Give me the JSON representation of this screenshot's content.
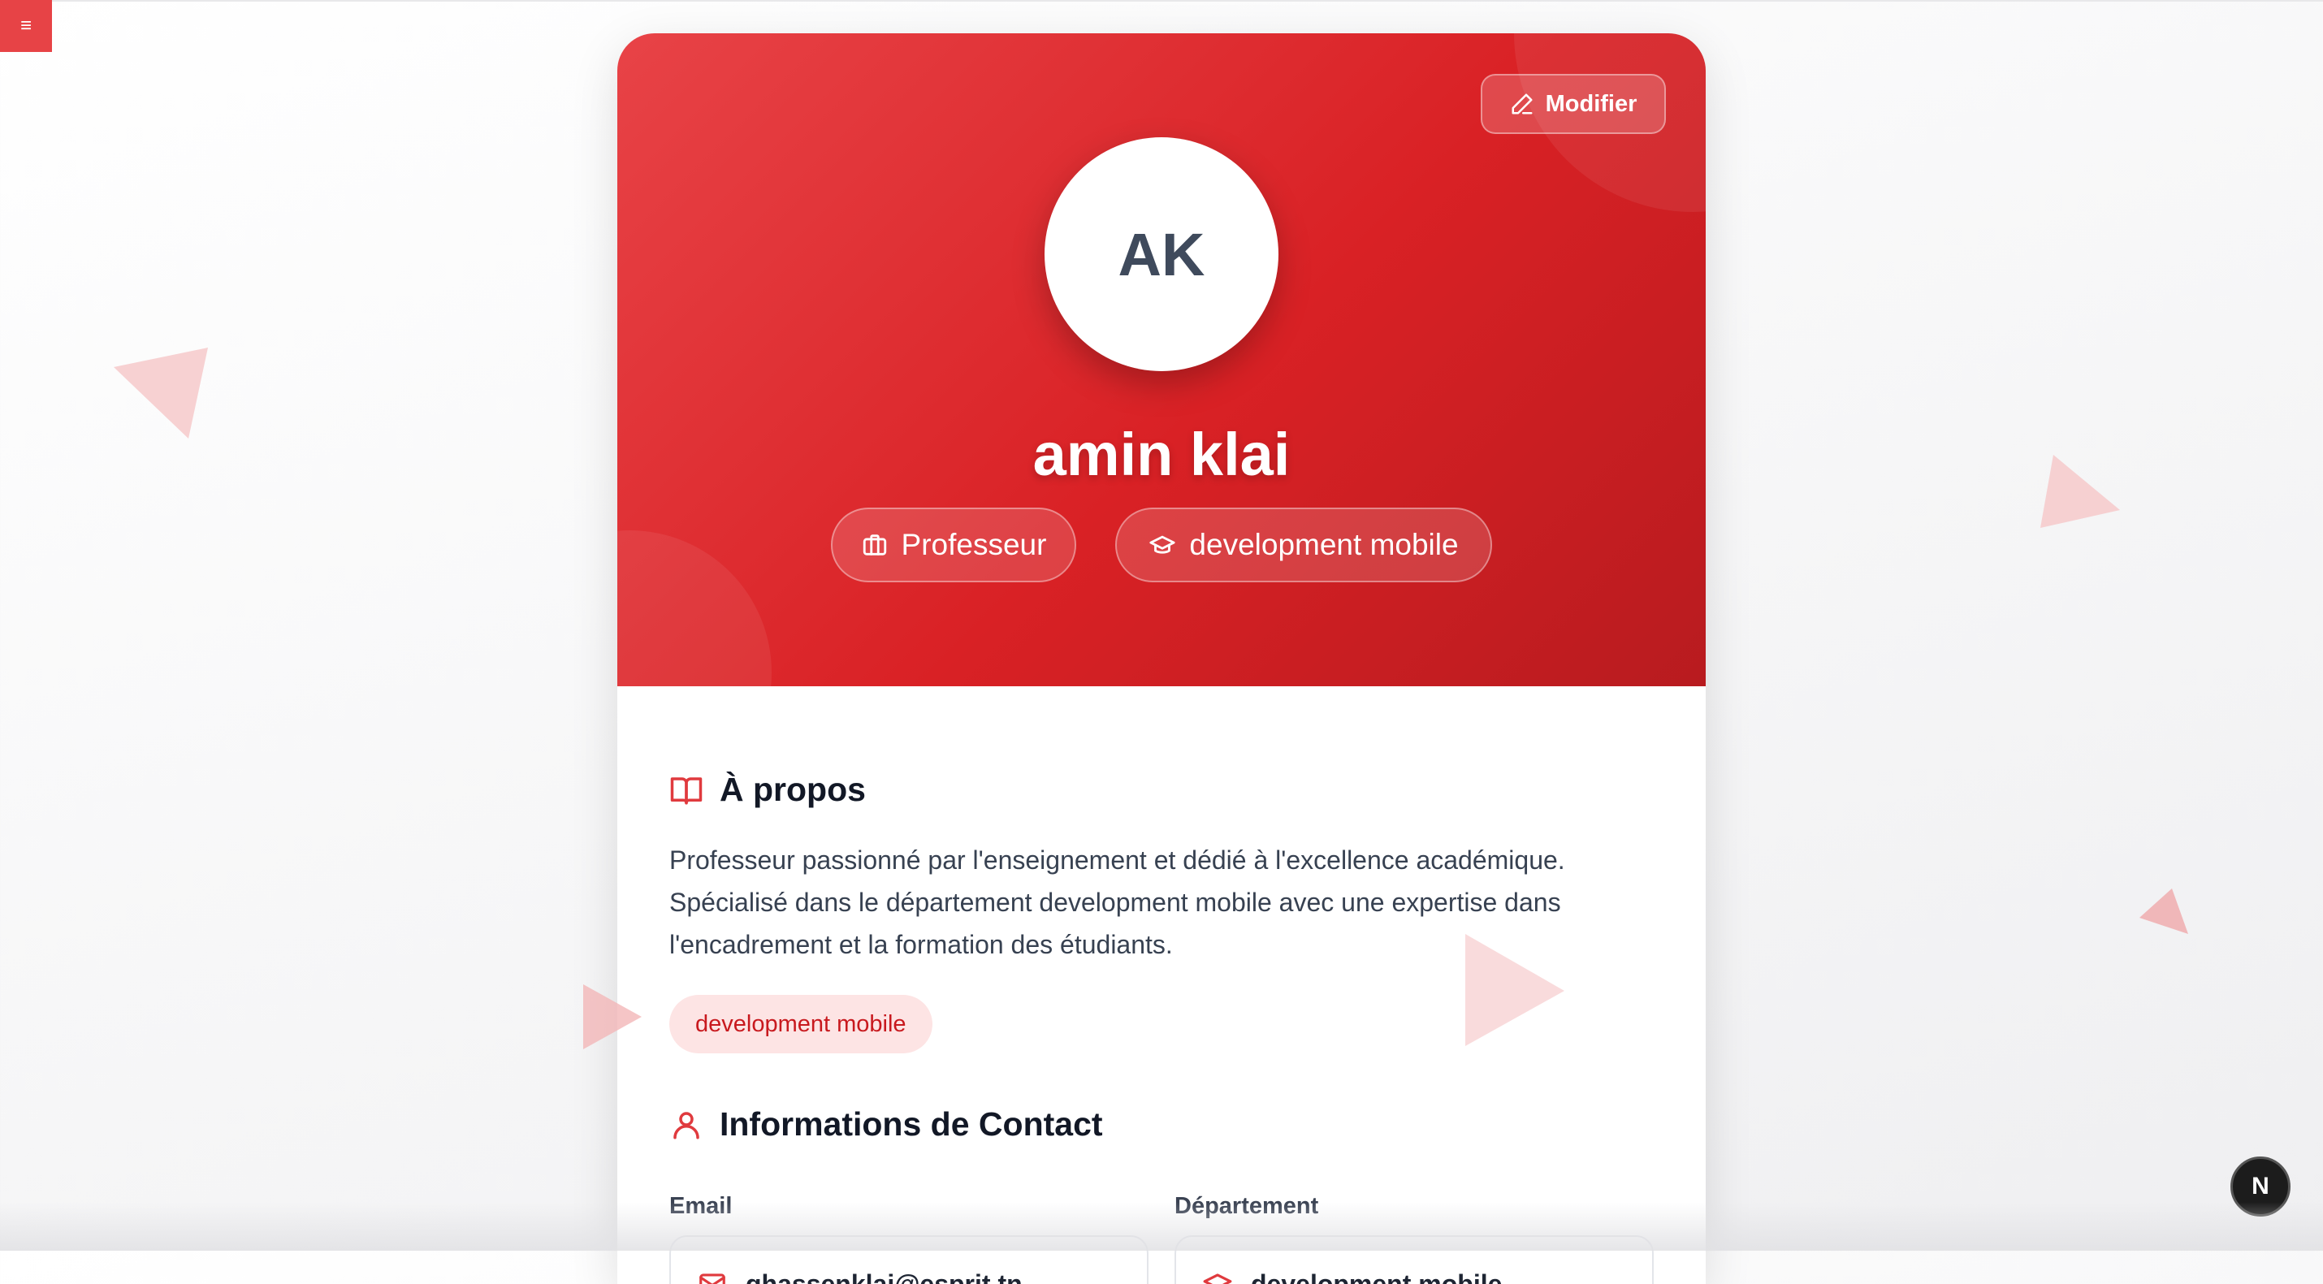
{
  "menu": {
    "icon": "menu-icon",
    "glyph": "≡"
  },
  "header": {
    "edit_label": "Modifier",
    "avatar_initials": "AK",
    "name": "amin klai",
    "chips": [
      {
        "icon": "briefcase-icon",
        "label": "Professeur"
      },
      {
        "icon": "graduation-cap-icon",
        "label": "development mobile"
      }
    ]
  },
  "about": {
    "title": "À propos",
    "icon": "book-open-icon",
    "text": "Professeur passionné par l'enseignement et dédié à l'excellence académique. Spécialisé dans le département development mobile avec une expertise dans l'encadrement et la formation des étudiants.",
    "tag": "development mobile"
  },
  "contact": {
    "title": "Informations de Contact",
    "icon": "user-icon",
    "fields": [
      {
        "label": "Email",
        "icon": "mail-icon",
        "value": "ghassenklai@esprit.tn"
      },
      {
        "label": "Département",
        "icon": "graduation-cap-icon",
        "value": "development mobile"
      }
    ]
  },
  "corner_badge": {
    "label": "N",
    "icon": "next-logo-icon"
  },
  "colors": {
    "accent": "#d92125",
    "accent_light": "#fde4e4",
    "text": "#1e2533"
  }
}
